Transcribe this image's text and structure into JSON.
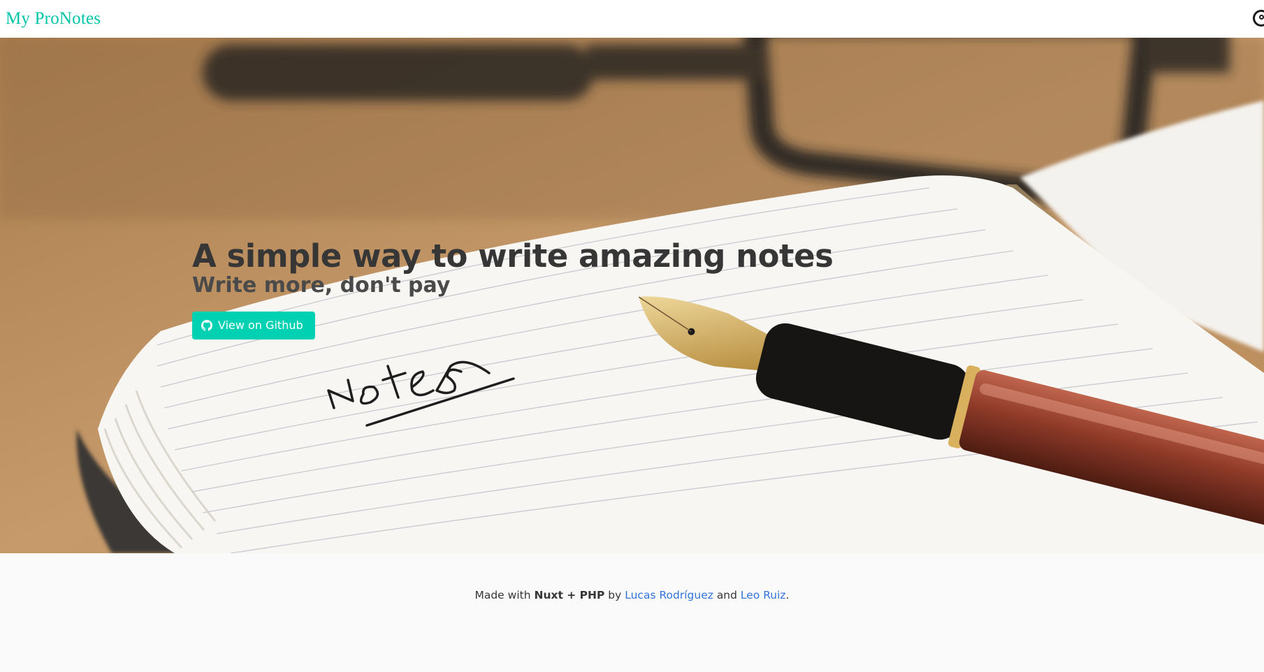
{
  "navbar": {
    "brand": "My ProNotes",
    "account_icon": "account-circle-icon"
  },
  "hero": {
    "title": "A simple way to write amazing notes",
    "subtitle": "Write more, don't pay",
    "button_label": "View on Github",
    "button_icon": "github-icon",
    "notebook_handwriting": "Notes",
    "colors": {
      "button": "#00d1b2",
      "brand": "#00c4a7"
    }
  },
  "footer": {
    "made_with": "Made with",
    "tech": "Nuxt + PHP",
    "by": "by",
    "author1": "Lucas Rodríguez",
    "and": "and",
    "author2": "Leo Ruiz",
    "period": "."
  }
}
